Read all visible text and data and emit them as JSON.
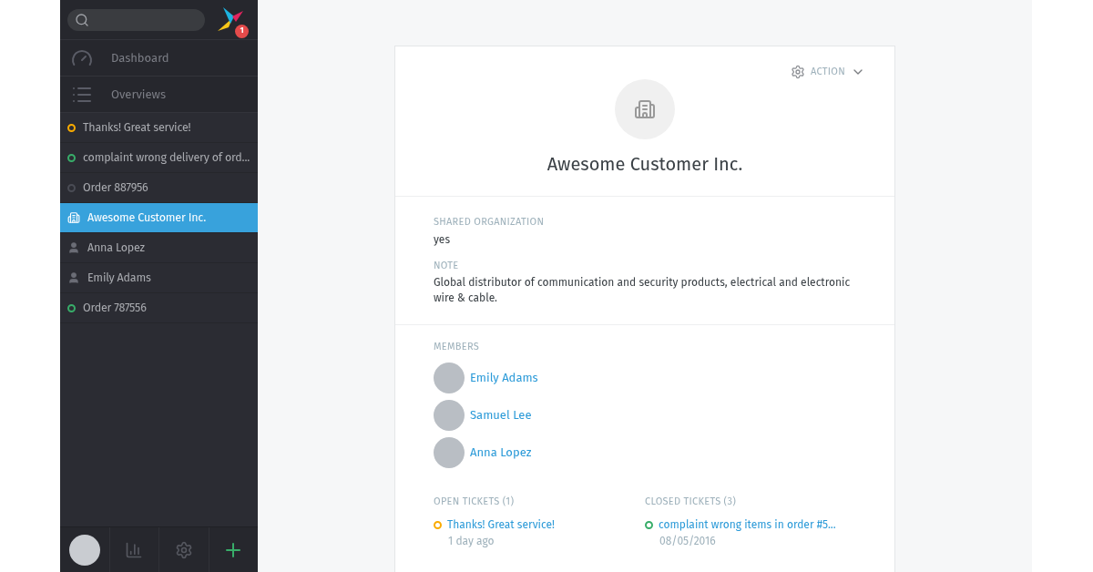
{
  "sidebar": {
    "notification_count": "1",
    "nav": [
      {
        "kind": "dashboard",
        "label": "Dashboard"
      },
      {
        "kind": "overviews",
        "label": "Overviews"
      }
    ],
    "items": [
      {
        "kind": "ticket",
        "label": "Thanks! Great service!",
        "color": "#faab00",
        "selected": false
      },
      {
        "kind": "ticket",
        "label": "complaint wrong delivery of ord...",
        "color": "#38ad69",
        "selected": false
      },
      {
        "kind": "ticket",
        "label": "Order 887956",
        "color": "#4a4c55",
        "selected": false
      },
      {
        "kind": "organization",
        "label": "Awesome Customer Inc.",
        "selected": true
      },
      {
        "kind": "user",
        "label": "Anna Lopez",
        "selected": false
      },
      {
        "kind": "user",
        "label": "Emily Adams",
        "selected": false
      },
      {
        "kind": "ticket",
        "label": "Order 787556",
        "color": "#38ad69",
        "selected": false
      }
    ]
  },
  "organization": {
    "action": "ACTION",
    "name": "Awesome Customer Inc.",
    "fields": [
      {
        "label": "SHARED ORGANIZATION",
        "value": "yes"
      },
      {
        "label": "NOTE",
        "value": "Global distributor of communication and security products, electrical and electronic wire & cable."
      }
    ],
    "members_label": "MEMBERS",
    "members": [
      "Emily Adams",
      "Samuel Lee",
      "Anna Lopez"
    ],
    "ticket_groups": [
      {
        "label": "OPEN TICKETS (1)",
        "tickets": [
          {
            "title": "Thanks! Great service!",
            "date": "1 day ago",
            "color": "#faab00"
          }
        ]
      },
      {
        "label": "CLOSED TICKETS (3)",
        "tickets": [
          {
            "title": "complaint wrong items in order #5...",
            "date": "08/05/2016",
            "color": "#38ad69"
          }
        ]
      }
    ]
  }
}
